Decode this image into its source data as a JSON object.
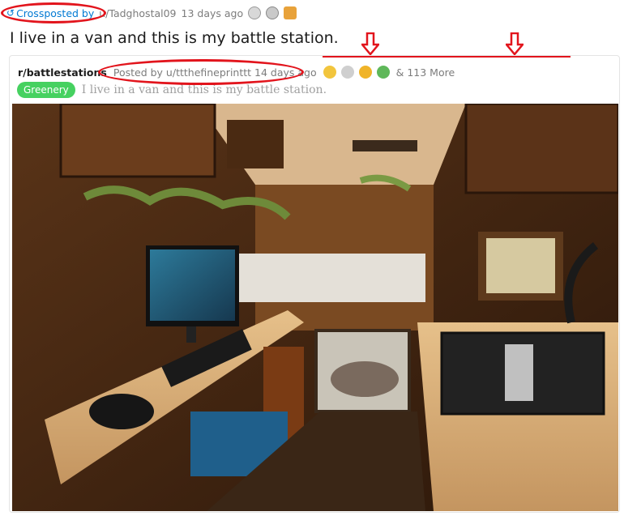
{
  "crosspost": {
    "icon": "crosspost-icon",
    "label": "Crossposted by",
    "user": "Tadghostal09",
    "user_prefix": "u/",
    "age": "13 days ago"
  },
  "post": {
    "title": "I live in a van and this is my battle station."
  },
  "original": {
    "subreddit": "r/battlestations",
    "posted_by": "Posted by u/ttthefineprinttt 14 days ago",
    "more_awards": "& 113 More",
    "flair": "Greenery",
    "title": "I live in a van and this is my battle station."
  },
  "colors": {
    "annotation_red": "#e2141c",
    "link_blue": "#0079d3",
    "flair_green": "#46d160"
  }
}
